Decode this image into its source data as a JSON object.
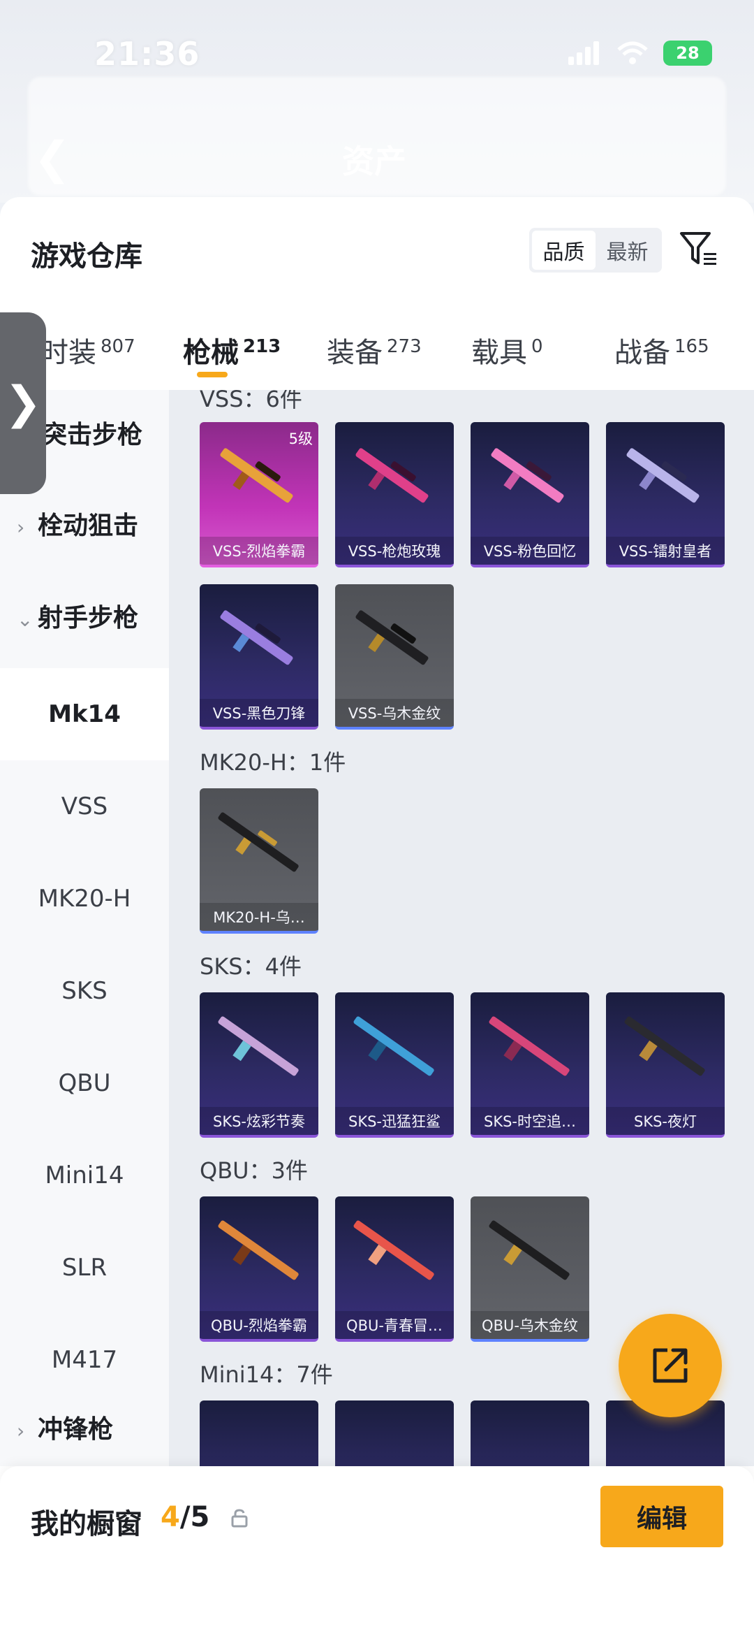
{
  "status_bar": {
    "time": "21:36",
    "battery": "28"
  },
  "nav": {
    "title": "资产"
  },
  "panel": {
    "title": "游戏仓库",
    "sort": {
      "quality": "品质",
      "latest": "最新"
    }
  },
  "tabs": [
    {
      "label": "时装",
      "count": "807"
    },
    {
      "label": "枪械",
      "count": "213"
    },
    {
      "label": "装备",
      "count": "273"
    },
    {
      "label": "载具",
      "count": "0"
    },
    {
      "label": "战备",
      "count": "165"
    }
  ],
  "sidebar": {
    "cats": {
      "assault": "突击步枪",
      "bolt": "栓动狙击",
      "marksman": "射手步枪",
      "smg": "冲锋枪"
    },
    "items": [
      "Mk14",
      "VSS",
      "MK20-H",
      "SKS",
      "QBU",
      "Mini14",
      "SLR",
      "M417"
    ]
  },
  "groups": {
    "vss": "VSS：6件",
    "mk20": "MK20-H：1件",
    "sks": "SKS：4件",
    "qbu": "QBU：3件",
    "mini14": "Mini14：7件"
  },
  "cards": {
    "vss1": "VSS-烈焰拳霸",
    "vss1_level": "5级",
    "vss2": "VSS-枪炮玫瑰",
    "vss3": "VSS-粉色回忆",
    "vss4": "VSS-镭射皇者",
    "vss5": "VSS-黑色刀锋",
    "vss6": "VSS-乌木金纹",
    "mk20_1": "MK20-H-乌…",
    "sks1": "SKS-炫彩节奏",
    "sks2": "SKS-迅猛狂鲨",
    "sks3": "SKS-时空追…",
    "sks4": "SKS-夜灯",
    "qbu1": "QBU-烈焰拳霸",
    "qbu2": "QBU-青春冒…",
    "qbu3": "QBU-乌木金纹"
  },
  "bottom": {
    "label": "我的橱窗",
    "current": "4",
    "total": "/5",
    "edit": "编辑"
  }
}
